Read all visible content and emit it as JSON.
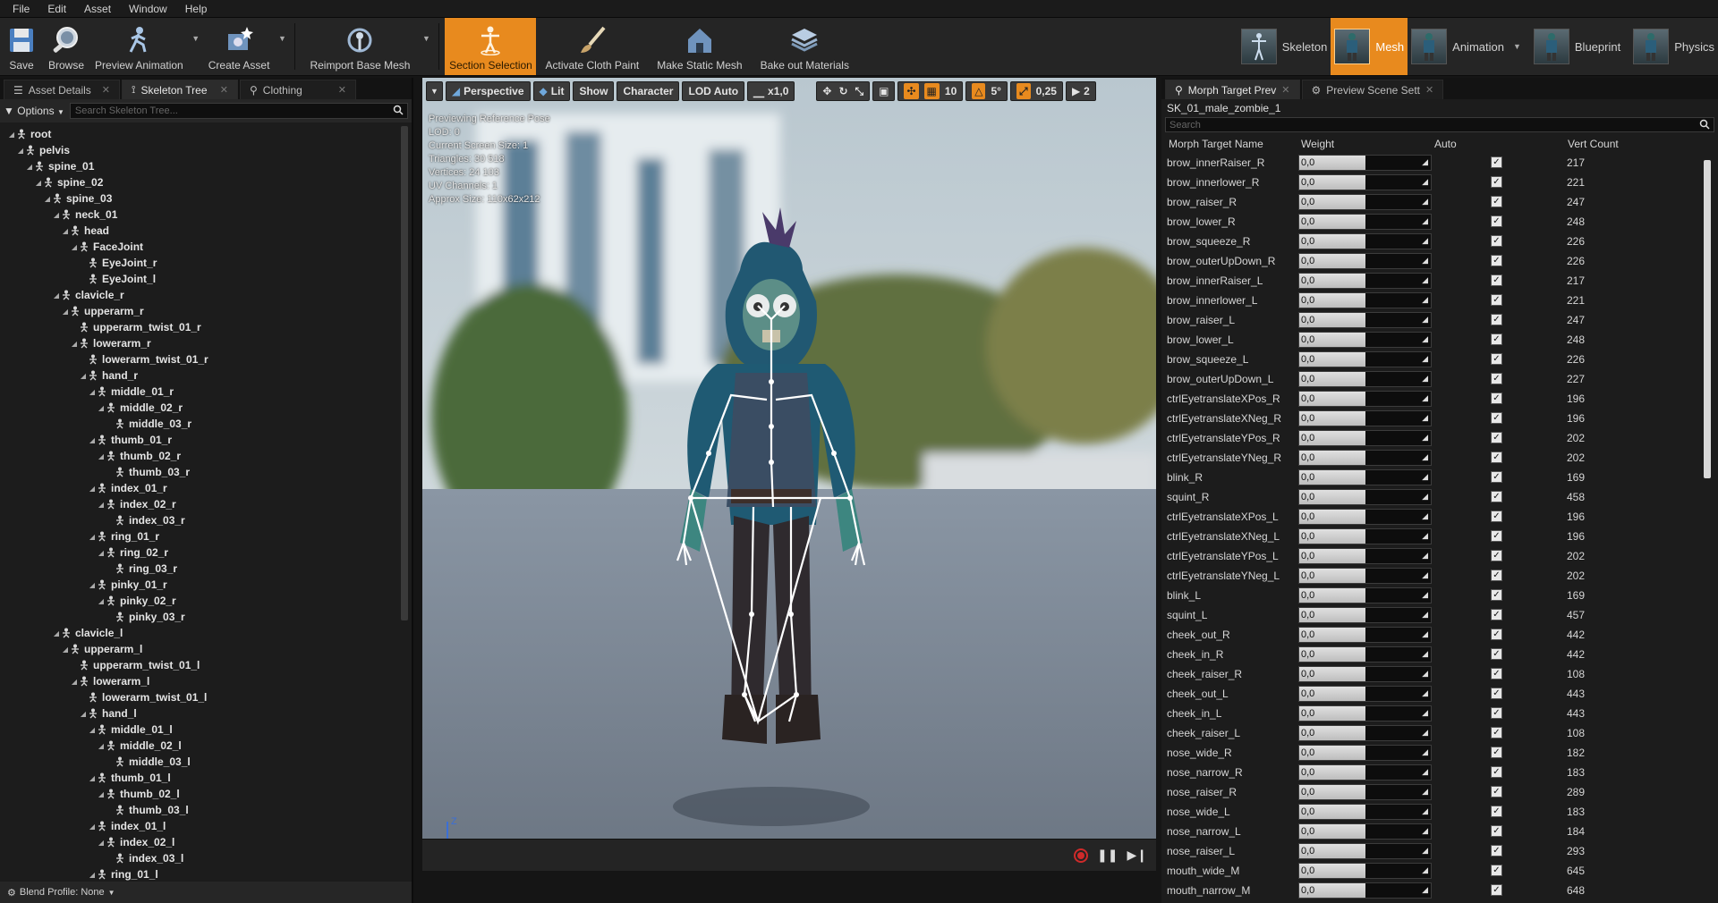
{
  "menu": [
    "File",
    "Edit",
    "Asset",
    "Window",
    "Help"
  ],
  "toolbar": {
    "save": "Save",
    "browse": "Browse",
    "preview_animation": "Preview Animation",
    "create_asset": "Create Asset",
    "reimport": "Reimport Base Mesh",
    "section_selection": "Section Selection",
    "cloth_paint": "Activate Cloth Paint",
    "static_mesh": "Make Static Mesh",
    "bake_materials": "Bake out Materials"
  },
  "modes": {
    "skeleton": "Skeleton",
    "mesh": "Mesh",
    "animation": "Animation",
    "blueprint": "Blueprint",
    "physics": "Physics"
  },
  "left_tabs": [
    "Asset Details",
    "Skeleton Tree",
    "Clothing"
  ],
  "options_label": "Options",
  "skeleton_search_placeholder": "Search Skeleton Tree...",
  "blend_profile": "Blend Profile: None",
  "bones": [
    "root",
    "pelvis",
    "spine_01",
    "spine_02",
    "spine_03",
    "neck_01",
    "head",
    "FaceJoint",
    "EyeJoint_r",
    "EyeJoint_l",
    "clavicle_r",
    "upperarm_r",
    "upperarm_twist_01_r",
    "lowerarm_r",
    "lowerarm_twist_01_r",
    "hand_r",
    "middle_01_r",
    "middle_02_r",
    "middle_03_r",
    "thumb_01_r",
    "thumb_02_r",
    "thumb_03_r",
    "index_01_r",
    "index_02_r",
    "index_03_r",
    "ring_01_r",
    "ring_02_r",
    "ring_03_r",
    "pinky_01_r",
    "pinky_02_r",
    "pinky_03_r",
    "clavicle_l",
    "upperarm_l",
    "upperarm_twist_01_l",
    "lowerarm_l",
    "lowerarm_twist_01_l",
    "hand_l",
    "middle_01_l",
    "middle_02_l",
    "middle_03_l",
    "thumb_01_l",
    "thumb_02_l",
    "thumb_03_l",
    "index_01_l",
    "index_02_l",
    "index_03_l",
    "ring_01_l"
  ],
  "viewport": {
    "perspective": "Perspective",
    "lit": "Lit",
    "show": "Show",
    "character": "Character",
    "lod": "LOD Auto",
    "speed": "x1,0",
    "grid": "10",
    "angle": "5°",
    "scale": "0,25",
    "cam": "2",
    "stats": [
      "Previewing Reference Pose",
      "LOD: 0",
      "Current Screen Size: 1",
      "Triangles: 30 518",
      "Vertices: 24 103",
      "UV Channels: 1",
      "Approx Size: 110x62x212"
    ],
    "axis_z": "Z",
    "axis_x": "X"
  },
  "right_tabs": [
    "Morph Target Prev",
    "Preview Scene Sett"
  ],
  "mesh_name": "SK_01_male_zombie_1",
  "morph_search_placeholder": "Search",
  "morph_headers": {
    "name": "Morph Target Name",
    "weight": "Weight",
    "auto": "Auto",
    "count": "Vert Count"
  },
  "morphs": [
    {
      "name": "brow_innerRaiser_R",
      "weight": "0,0",
      "count": "217"
    },
    {
      "name": "brow_innerlower_R",
      "weight": "0,0",
      "count": "221"
    },
    {
      "name": "brow_raiser_R",
      "weight": "0,0",
      "count": "247"
    },
    {
      "name": "brow_lower_R",
      "weight": "0,0",
      "count": "248"
    },
    {
      "name": "brow_squeeze_R",
      "weight": "0,0",
      "count": "226"
    },
    {
      "name": "brow_outerUpDown_R",
      "weight": "0,0",
      "count": "226"
    },
    {
      "name": "brow_innerRaiser_L",
      "weight": "0,0",
      "count": "217"
    },
    {
      "name": "brow_innerlower_L",
      "weight": "0,0",
      "count": "221"
    },
    {
      "name": "brow_raiser_L",
      "weight": "0,0",
      "count": "247"
    },
    {
      "name": "brow_lower_L",
      "weight": "0,0",
      "count": "248"
    },
    {
      "name": "brow_squeeze_L",
      "weight": "0,0",
      "count": "226"
    },
    {
      "name": "brow_outerUpDown_L",
      "weight": "0,0",
      "count": "227"
    },
    {
      "name": "ctrlEyetranslateXPos_R",
      "weight": "0,0",
      "count": "196"
    },
    {
      "name": "ctrlEyetranslateXNeg_R",
      "weight": "0,0",
      "count": "196"
    },
    {
      "name": "ctrlEyetranslateYPos_R",
      "weight": "0,0",
      "count": "202"
    },
    {
      "name": "ctrlEyetranslateYNeg_R",
      "weight": "0,0",
      "count": "202"
    },
    {
      "name": "blink_R",
      "weight": "0,0",
      "count": "169"
    },
    {
      "name": "squint_R",
      "weight": "0,0",
      "count": "458"
    },
    {
      "name": "ctrlEyetranslateXPos_L",
      "weight": "0,0",
      "count": "196"
    },
    {
      "name": "ctrlEyetranslateXNeg_L",
      "weight": "0,0",
      "count": "196"
    },
    {
      "name": "ctrlEyetranslateYPos_L",
      "weight": "0,0",
      "count": "202"
    },
    {
      "name": "ctrlEyetranslateYNeg_L",
      "weight": "0,0",
      "count": "202"
    },
    {
      "name": "blink_L",
      "weight": "0,0",
      "count": "169"
    },
    {
      "name": "squint_L",
      "weight": "0,0",
      "count": "457"
    },
    {
      "name": "cheek_out_R",
      "weight": "0,0",
      "count": "442"
    },
    {
      "name": "cheek_in_R",
      "weight": "0,0",
      "count": "442"
    },
    {
      "name": "cheek_raiser_R",
      "weight": "0,0",
      "count": "108"
    },
    {
      "name": "cheek_out_L",
      "weight": "0,0",
      "count": "443"
    },
    {
      "name": "cheek_in_L",
      "weight": "0,0",
      "count": "443"
    },
    {
      "name": "cheek_raiser_L",
      "weight": "0,0",
      "count": "108"
    },
    {
      "name": "nose_wide_R",
      "weight": "0,0",
      "count": "182"
    },
    {
      "name": "nose_narrow_R",
      "weight": "0,0",
      "count": "183"
    },
    {
      "name": "nose_raiser_R",
      "weight": "0,0",
      "count": "289"
    },
    {
      "name": "nose_wide_L",
      "weight": "0,0",
      "count": "183"
    },
    {
      "name": "nose_narrow_L",
      "weight": "0,0",
      "count": "184"
    },
    {
      "name": "nose_raiser_L",
      "weight": "0,0",
      "count": "293"
    },
    {
      "name": "mouth_wide_M",
      "weight": "0,0",
      "count": "645"
    },
    {
      "name": "mouth_narrow_M",
      "weight": "0,0",
      "count": "648"
    }
  ],
  "colors": {
    "accent": "#e88a1e",
    "panel": "#1c1c1c"
  }
}
